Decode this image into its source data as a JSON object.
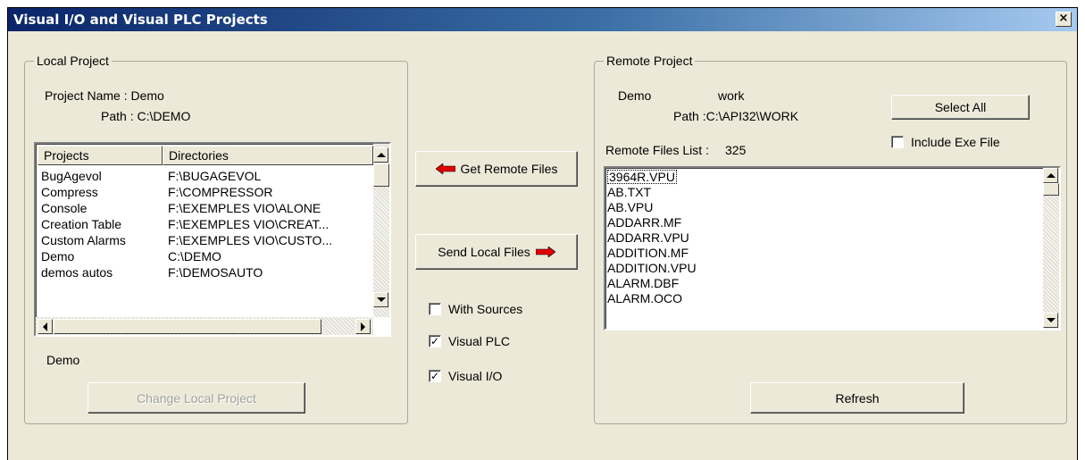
{
  "window": {
    "title": "Visual I/O and Visual PLC Projects",
    "close_label": "×"
  },
  "local": {
    "legend": "Local Project",
    "project_name_label": "Project Name : Demo",
    "path_label": "Path :  C:\\DEMO",
    "columns": [
      "Projects",
      "Directories"
    ],
    "rows": [
      {
        "name": "BugAgevol",
        "dir": "F:\\BUGAGEVOL"
      },
      {
        "name": "Compress",
        "dir": "F:\\COMPRESSOR"
      },
      {
        "name": "Console",
        "dir": "F:\\EXEMPLES VIO\\ALONE"
      },
      {
        "name": "Creation Table",
        "dir": "F:\\EXEMPLES VIO\\CREAT..."
      },
      {
        "name": "Custom Alarms",
        "dir": "F:\\EXEMPLES VIO\\CUSTO..."
      },
      {
        "name": "Demo",
        "dir": "C:\\DEMO"
      },
      {
        "name": "demos autos",
        "dir": "F:\\DEMOSAUTO"
      }
    ],
    "selected_project": "Demo",
    "change_button": "Change Local Project"
  },
  "middle": {
    "get_remote_button": "Get Remote Files",
    "send_local_button": "Send Local Files",
    "with_sources": {
      "label": "With Sources",
      "checked": false
    },
    "visual_plc": {
      "label": "Visual PLC",
      "checked": true
    },
    "visual_io": {
      "label": "Visual I/O",
      "checked": true
    },
    "arrow_color": "#e00000"
  },
  "remote": {
    "legend": "Remote Project",
    "project_name": "Demo",
    "project_dir": "work",
    "path_label": "Path  :C:\\API32\\WORK",
    "select_all_button": "Select  All",
    "include_exe": {
      "label": "Include Exe File",
      "checked": false
    },
    "files_list_label": "Remote Files List :",
    "files_count": "325",
    "files": [
      "3964R.VPU",
      "AB.TXT",
      "AB.VPU",
      "ADDARR.MF",
      "ADDARR.VPU",
      "ADDITION.MF",
      "ADDITION.VPU",
      "ALARM.DBF",
      "ALARM.OCO"
    ],
    "refresh_button": "Refresh"
  }
}
